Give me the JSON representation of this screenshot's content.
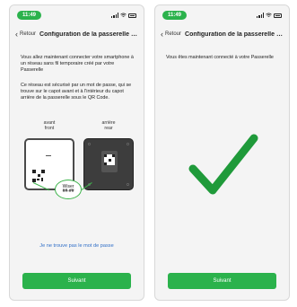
{
  "status_bar": {
    "time": "11:49"
  },
  "screen1": {
    "back_label": "Retour",
    "title": "Configuration de la passerelle d...",
    "para1": "Vous allez maintenant connecter votre smartphone à un réseau sans fil temporaire créé par votre Passerelle",
    "para2": "Ce réseau est sécurisé par un mot de passe, qui se trouve sur le capot avant et à l'intérieur du capot arrière de la passerelle sous le QR Code.",
    "front_label": "avant",
    "front_sublabel": "front",
    "rear_label": "arrière",
    "rear_sublabel": "rear",
    "wiser_brand": "Wiser",
    "wiser_code": "##-##",
    "password_link": "Je ne trouve pas le mot de passe",
    "next_button": "Suivant"
  },
  "screen2": {
    "back_label": "Retour",
    "title": "Configuration de la passerelle d...",
    "message": "Vous êtes maintenant connecté à votre Passerelle",
    "next_button": "Suivant"
  },
  "colors": {
    "accent": "#2bb24c",
    "link": "#2f6ec7",
    "checkmark": "#1f9a3a"
  }
}
